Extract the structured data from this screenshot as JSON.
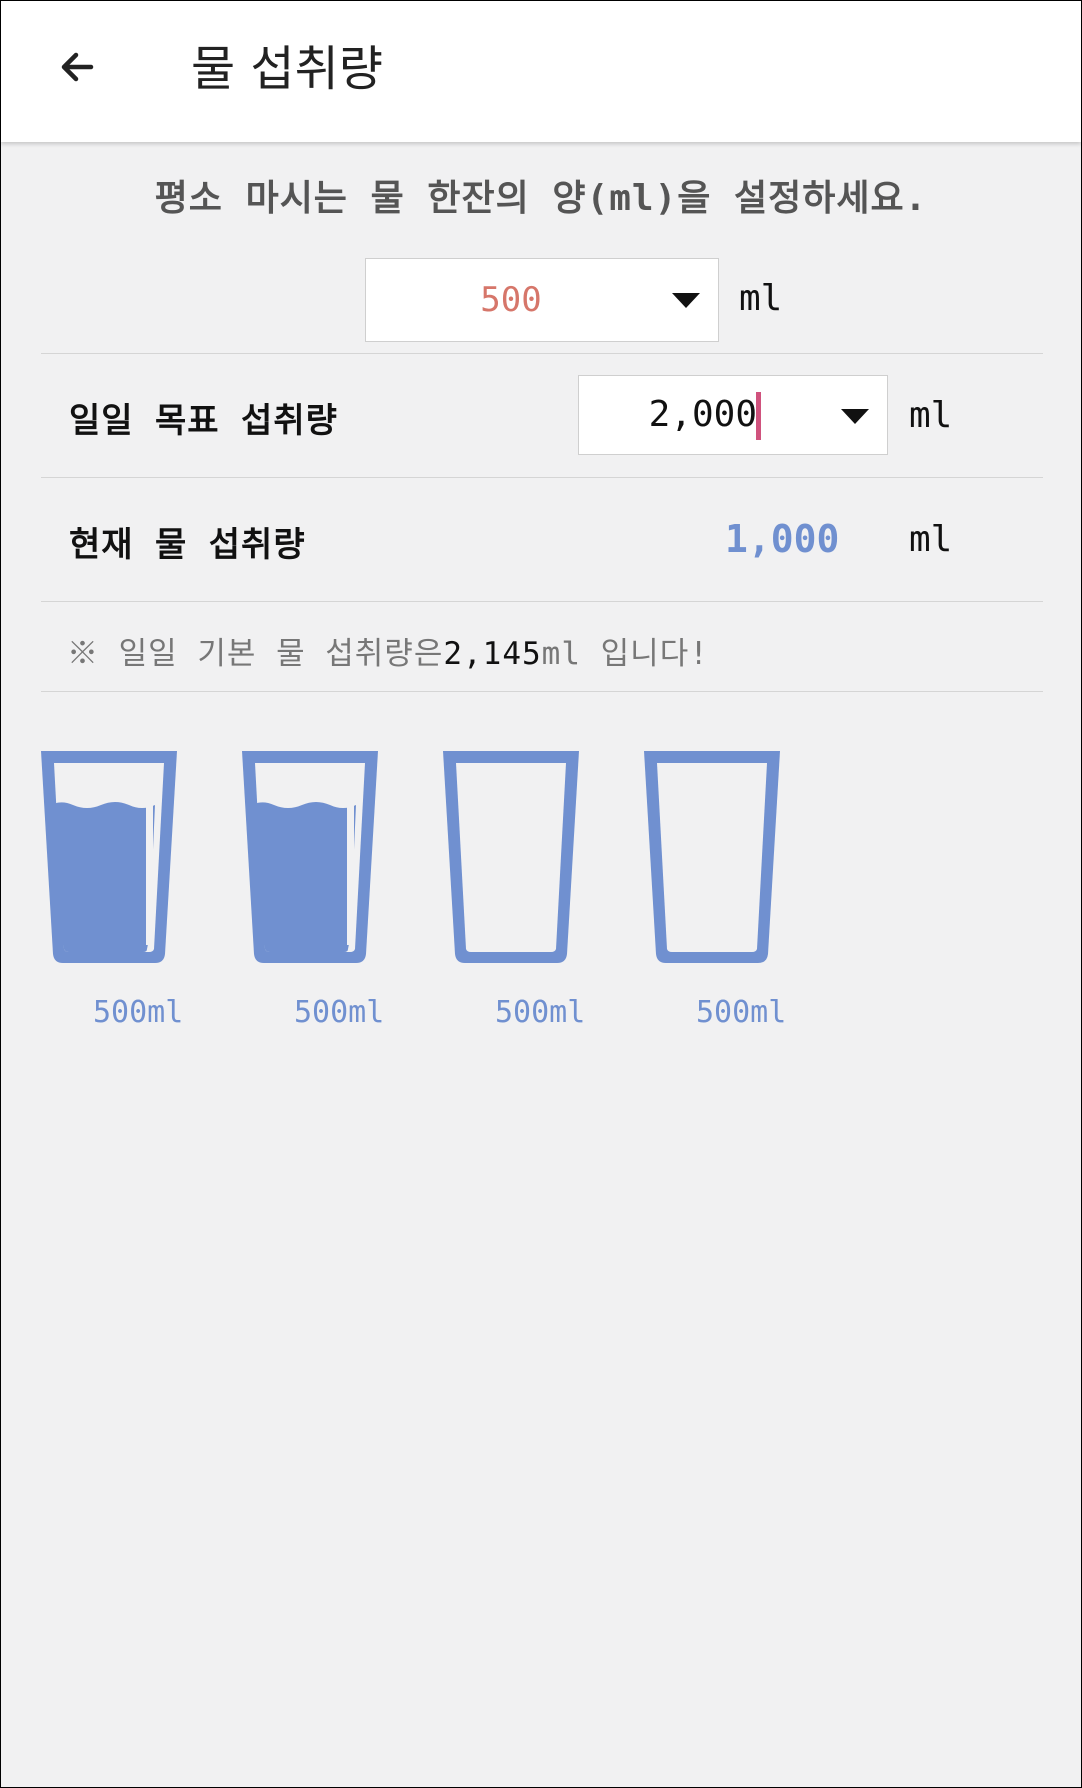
{
  "header": {
    "back_icon": "arrow-left-icon",
    "title": "물 섭취량"
  },
  "intro": "평소 마시는 물 한잔의 양(ml)을 설정하세요.",
  "glass_size": {
    "value": "500",
    "unit": "ml"
  },
  "daily_goal": {
    "label": "일일 목표 섭취량",
    "value": "2,000",
    "unit": "ml"
  },
  "current": {
    "label": "현재 물 섭취량",
    "value": "1,000",
    "unit": "ml"
  },
  "note": {
    "prefix": "※ 일일 기본 물 섭취량은",
    "number": "2,145",
    "suffix": "ml 입니다!"
  },
  "glasses": [
    {
      "label": "500ml",
      "filled": true
    },
    {
      "label": "500ml",
      "filled": true
    },
    {
      "label": "500ml",
      "filled": false
    },
    {
      "label": "500ml",
      "filled": false
    }
  ],
  "colors": {
    "accent": "#7090d0",
    "glass_value": "#d6766a",
    "cursor": "#d0527d"
  }
}
